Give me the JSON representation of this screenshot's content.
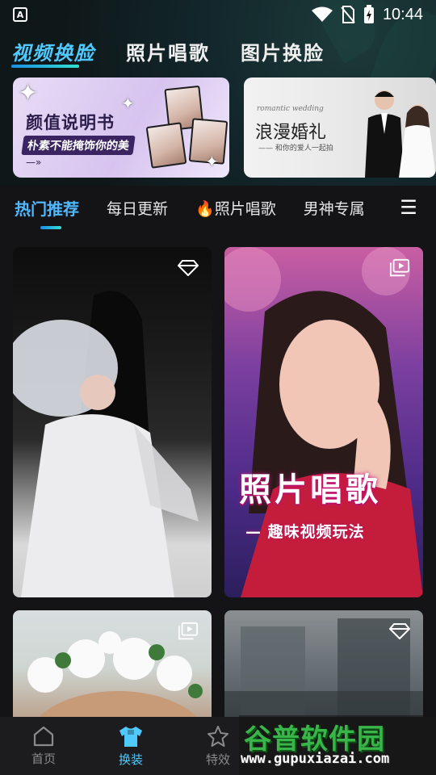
{
  "status_bar": {
    "time": "10:44",
    "app_icon_label": "A"
  },
  "top_tabs": [
    {
      "label": "视频换脸",
      "active": true
    },
    {
      "label": "照片唱歌",
      "active": false
    },
    {
      "label": "图片换脸",
      "active": false
    }
  ],
  "banners": [
    {
      "title": "颜值说明书",
      "subtitle": "朴素不能掩饰你的美",
      "arrow": "—»"
    },
    {
      "en": "romantic wedding",
      "title": "浪漫婚礼",
      "subtitle": "—— 和你的爱人一起拍"
    }
  ],
  "categories": [
    {
      "label": "热门推荐",
      "active": true
    },
    {
      "label": "每日更新",
      "active": false
    },
    {
      "label": "照片唱歌",
      "icon": "fire-icon",
      "active": false
    },
    {
      "label": "男神专属",
      "active": false
    }
  ],
  "cards": [
    {
      "badge": "diamond-icon",
      "overlay_title": "",
      "overlay_sub": ""
    },
    {
      "badge": "video-stack-icon",
      "overlay_title": "照片唱歌",
      "overlay_sub": "— 趣味视频玩法"
    },
    {
      "badge": "video-stack-icon"
    },
    {
      "badge": "diamond-icon"
    }
  ],
  "bottom_nav": [
    {
      "label": "首页",
      "icon": "home-icon",
      "active": false
    },
    {
      "label": "换装",
      "icon": "shirt-icon",
      "active": true
    },
    {
      "label": "特效",
      "icon": "star-icon",
      "active": false
    }
  ],
  "watermark": {
    "title": "谷普软件园",
    "url": "www.gupuxiazai.com"
  },
  "colors": {
    "accent": "#4fc9ff",
    "background": "#141416",
    "nav_bg": "#1c1c1e"
  }
}
